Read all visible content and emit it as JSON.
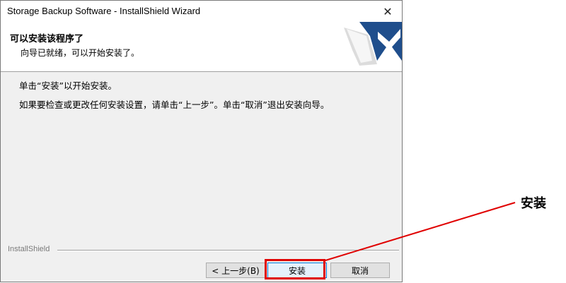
{
  "window": {
    "title": "Storage Backup Software - InstallShield Wizard",
    "close_glyph": "✕"
  },
  "header": {
    "title": "可以安装该程序了",
    "subtitle": "向导已就绪，可以开始安装了。"
  },
  "body": {
    "line1": "单击“安装”以开始安装。",
    "line2": "如果要检查或更改任何安装设置，请单击“上一步”。单击“取消”退出安装向导。"
  },
  "footer": {
    "brand": "InstallShield"
  },
  "buttons": {
    "back": "< 上一步(B)",
    "install": "安装",
    "cancel": "取消"
  },
  "annotation": {
    "label": "安装",
    "color": "#e00000"
  }
}
